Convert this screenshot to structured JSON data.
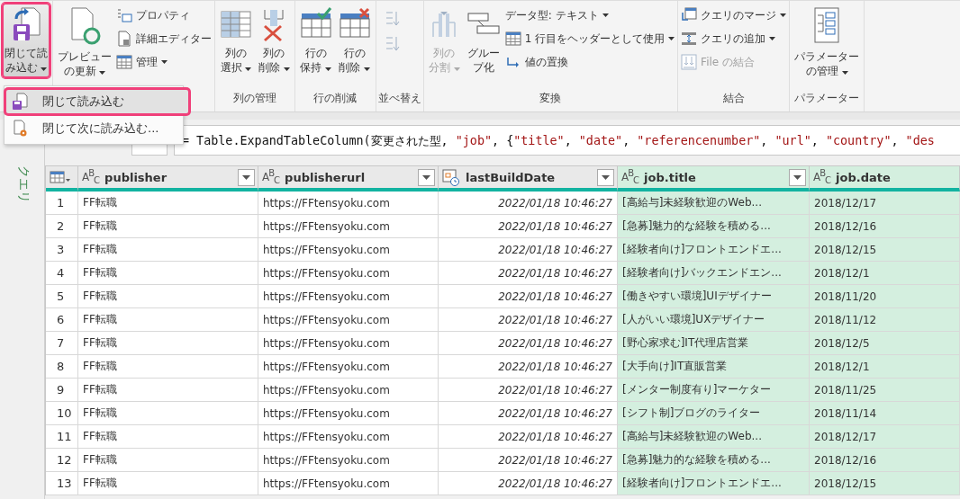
{
  "ribbon": {
    "groups": [
      {
        "big": [
          {
            "label_lines": [
              "閉じて読",
              "み込む"
            ],
            "has_menu": true,
            "pressed": true,
            "highlighted": true,
            "disabled": false
          }
        ]
      },
      {
        "big": [
          {
            "label_lines": [
              "プレビュー",
              "の更新"
            ],
            "has_menu": true,
            "pressed": false,
            "highlighted": false,
            "disabled": false
          }
        ],
        "small": [
          {
            "label": "プロパティ",
            "has_menu": false,
            "disabled": false
          },
          {
            "label": "詳細エディター",
            "has_menu": false,
            "disabled": false
          },
          {
            "label": "管理",
            "has_menu": true,
            "disabled": false
          }
        ]
      },
      {
        "label": "列の管理",
        "big": [
          {
            "label_lines": [
              "列の",
              "選択"
            ],
            "has_menu": true,
            "pressed": false,
            "highlighted": false,
            "disabled": false
          },
          {
            "label_lines": [
              "列の",
              "削除"
            ],
            "has_menu": true,
            "pressed": false,
            "highlighted": false,
            "disabled": false
          }
        ]
      },
      {
        "label": "行の削減",
        "big": [
          {
            "label_lines": [
              "行の",
              "保持"
            ],
            "has_menu": true,
            "pressed": false,
            "highlighted": false,
            "disabled": false
          },
          {
            "label_lines": [
              "行の",
              "削除"
            ],
            "has_menu": true,
            "pressed": false,
            "highlighted": false,
            "disabled": false
          }
        ]
      },
      {
        "label": "並べ替え",
        "sort": true
      },
      {
        "label": "変換",
        "big": [
          {
            "label_lines": [
              "列の",
              "分割"
            ],
            "has_menu": true,
            "pressed": false,
            "highlighted": false,
            "disabled": true
          },
          {
            "label_lines": [
              "グルー",
              "プ化"
            ],
            "has_menu": false,
            "pressed": false,
            "highlighted": false,
            "disabled": false
          }
        ],
        "small": [
          {
            "label": "データ型: テキスト",
            "has_menu": true,
            "disabled": false
          },
          {
            "label": "1 行目をヘッダーとして使用",
            "has_menu": true,
            "disabled": false
          },
          {
            "label": "値の置換",
            "has_menu": false,
            "disabled": false
          }
        ]
      },
      {
        "label": "結合",
        "small": [
          {
            "label": "クエリのマージ",
            "has_menu": true,
            "disabled": false
          },
          {
            "label": "クエリの追加",
            "has_menu": true,
            "disabled": false
          },
          {
            "label": "File の結合",
            "has_menu": false,
            "disabled": true
          }
        ]
      },
      {
        "label": "パラメーター",
        "big": [
          {
            "label_lines": [
              "パラメーター",
              "の管理"
            ],
            "has_menu": true,
            "pressed": false,
            "highlighted": false,
            "disabled": false
          }
        ]
      }
    ]
  },
  "dropdown": {
    "items": [
      {
        "label": "閉じて読み込む",
        "highlighted": true,
        "selected": true
      },
      {
        "label": "閉じて次に読み込む...",
        "highlighted": false,
        "selected": false
      }
    ]
  },
  "side_panel": {
    "title": "クエリ"
  },
  "formula": {
    "tokens": [
      {
        "text": "= Table.ExpandTableColumn(変更された型, ",
        "kind": "plain"
      },
      {
        "text": "\"job\"",
        "kind": "string"
      },
      {
        "text": ", {",
        "kind": "plain"
      },
      {
        "text": "\"title\"",
        "kind": "string"
      },
      {
        "text": ", ",
        "kind": "plain"
      },
      {
        "text": "\"date\"",
        "kind": "string"
      },
      {
        "text": ", ",
        "kind": "plain"
      },
      {
        "text": "\"referencenumber\"",
        "kind": "string"
      },
      {
        "text": ", ",
        "kind": "plain"
      },
      {
        "text": "\"url\"",
        "kind": "string"
      },
      {
        "text": ", ",
        "kind": "plain"
      },
      {
        "text": "\"country\"",
        "kind": "string"
      },
      {
        "text": ", ",
        "kind": "plain"
      },
      {
        "text": "\"des",
        "kind": "string"
      }
    ]
  },
  "table": {
    "columns": [
      {
        "name": "publisher",
        "kind": "text",
        "type_label": "A$^{B}$$_{C}$",
        "filter_button": true,
        "highlighted": false
      },
      {
        "name": "publisherurl",
        "kind": "text",
        "type_label": "A$^{B}$$_{C}$",
        "filter_button": true,
        "highlighted": false
      },
      {
        "name": "lastBuildDate",
        "kind": "datetime",
        "filter_button": true,
        "highlighted": false
      },
      {
        "name": "job.title",
        "kind": "text",
        "type_label": "A$^{B}$$_{C}$",
        "filter_button": true,
        "highlighted": true
      },
      {
        "name": "job.date",
        "kind": "text",
        "type_label": "A$^{B}$$_{C}$",
        "filter_button": false,
        "highlighted": true
      }
    ],
    "rows": [
      {
        "number": "1",
        "cells": [
          "FF転職",
          "https://FFtensyoku.com",
          "2022/01/18 10:46:27",
          "[高給与]未経験歓迎のWeb...",
          "2018/12/17"
        ]
      },
      {
        "number": "2",
        "cells": [
          "FF転職",
          "https://FFtensyoku.com",
          "2022/01/18 10:46:27",
          "[急募]魅力的な経験を積める...",
          "2018/12/16"
        ]
      },
      {
        "number": "3",
        "cells": [
          "FF転職",
          "https://FFtensyoku.com",
          "2022/01/18 10:46:27",
          "[経験者向け]フロントエンドエ...",
          "2018/12/15"
        ]
      },
      {
        "number": "4",
        "cells": [
          "FF転職",
          "https://FFtensyoku.com",
          "2022/01/18 10:46:27",
          "[経験者向け]バックエンドエン...",
          "2018/12/1"
        ]
      },
      {
        "number": "5",
        "cells": [
          "FF転職",
          "https://FFtensyoku.com",
          "2022/01/18 10:46:27",
          "[働きやすい環境]UIデザイナー",
          "2018/11/20"
        ]
      },
      {
        "number": "6",
        "cells": [
          "FF転職",
          "https://FFtensyoku.com",
          "2022/01/18 10:46:27",
          "[人がいい環境]UXデザイナー",
          "2018/11/12"
        ]
      },
      {
        "number": "7",
        "cells": [
          "FF転職",
          "https://FFtensyoku.com",
          "2022/01/18 10:46:27",
          "[野心家求む]IT代理店営業",
          "2018/12/5"
        ]
      },
      {
        "number": "8",
        "cells": [
          "FF転職",
          "https://FFtensyoku.com",
          "2022/01/18 10:46:27",
          "[大手向け]IT直販営業",
          "2018/12/1"
        ]
      },
      {
        "number": "9",
        "cells": [
          "FF転職",
          "https://FFtensyoku.com",
          "2022/01/18 10:46:27",
          "[メンター制度有り]マーケター",
          "2018/11/25"
        ]
      },
      {
        "number": "10",
        "cells": [
          "FF転職",
          "https://FFtensyoku.com",
          "2022/01/18 10:46:27",
          "[シフト制]ブログのライター",
          "2018/11/14"
        ]
      },
      {
        "number": "11",
        "cells": [
          "FF転職",
          "https://FFtensyoku.com",
          "2022/01/18 10:46:27",
          "[高給与]未経験歓迎のWeb...",
          "2018/12/17"
        ]
      },
      {
        "number": "12",
        "cells": [
          "FF転職",
          "https://FFtensyoku.com",
          "2022/01/18 10:46:27",
          "[急募]魅力的な経験を積める...",
          "2018/12/16"
        ]
      },
      {
        "number": "13",
        "cells": [
          "FF転職",
          "https://FFtensyoku.com",
          "2022/01/18 10:46:27",
          "[経験者向け]フロントエンドエ...",
          "2018/12/15"
        ]
      }
    ]
  }
}
